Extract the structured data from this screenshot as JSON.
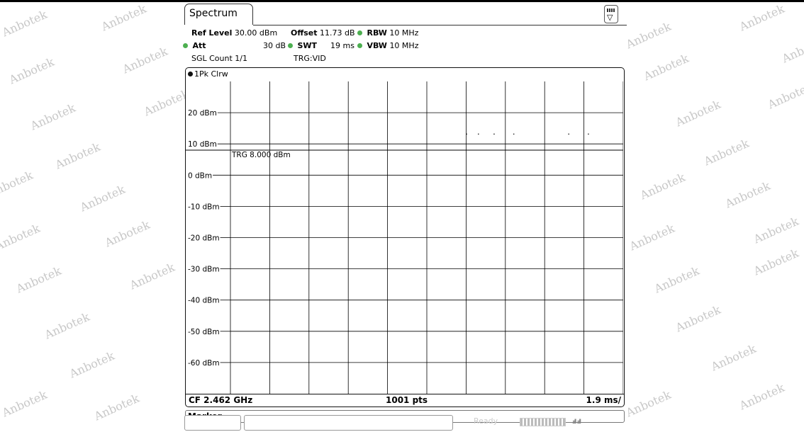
{
  "watermark": "Anbotek",
  "tab": {
    "label": "Spectrum"
  },
  "settings": {
    "ref_level_label": "Ref Level",
    "ref_level_value": "30.00 dBm",
    "offset_label": "Offset",
    "offset_value": "11.73 dB",
    "rbw_label": "RBW",
    "rbw_value": "10 MHz",
    "att_label": "Att",
    "att_value": "30 dB",
    "swt_label": "SWT",
    "swt_value": "19 ms",
    "vbw_label": "VBW",
    "vbw_value": "10 MHz",
    "sgl_count": "SGL Count 1/1",
    "trigger": "TRG:VID"
  },
  "trace": {
    "label": "1Pk Clrw"
  },
  "footer": {
    "cf": "CF 2.462 GHz",
    "points": "1001 pts",
    "div": "1.9 ms/"
  },
  "marker_bar": {
    "label": "Marker"
  },
  "status": {
    "ready": "Ready"
  },
  "colors": {
    "status_dot": "#4caf50",
    "grid": "#000000",
    "watermark": "#c8c8c8"
  },
  "chart_data": {
    "type": "line",
    "xlabel": "",
    "ylabel": "",
    "ylim": [
      -70,
      30
    ],
    "y_ticks": [
      {
        "value": 20,
        "label": "20 dBm"
      },
      {
        "value": 10,
        "label": "10 dBm"
      },
      {
        "value": 0,
        "label": "0 dBm"
      },
      {
        "value": -10,
        "label": "-10 dBm"
      },
      {
        "value": -20,
        "label": "-20 dBm"
      },
      {
        "value": -30,
        "label": "-30 dBm"
      },
      {
        "value": -40,
        "label": "-40 dBm"
      },
      {
        "value": -50,
        "label": "-50 dBm"
      },
      {
        "value": -60,
        "label": "-60 dBm"
      }
    ],
    "x_divisions": 10,
    "trigger_level": {
      "value": 8.0,
      "label": "TRG 8.000 dBm"
    },
    "series": [
      {
        "x_div": [
          6.0,
          6.3,
          6.7,
          7.2,
          8.6,
          9.1
        ],
        "values": [
          13.2,
          13.2,
          13.2,
          13.2,
          13.2,
          13.2
        ]
      }
    ]
  }
}
